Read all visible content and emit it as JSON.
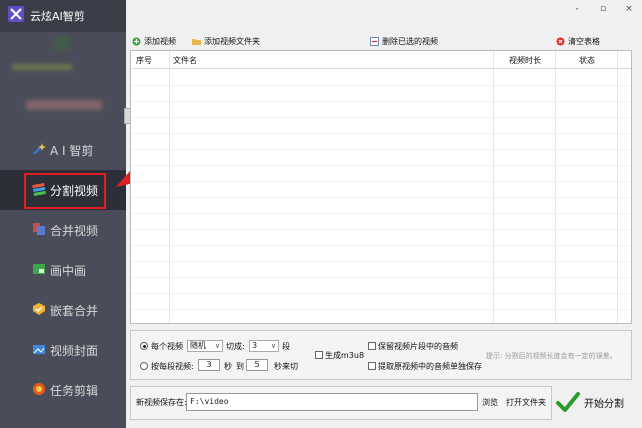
{
  "app": {
    "title": "云炫AI智剪"
  },
  "sidebar": {
    "items": [
      {
        "label": "A I 智剪",
        "icon": "ai-magic-icon",
        "active": false
      },
      {
        "label": "分割视频",
        "icon": "split-video-icon",
        "active": true
      },
      {
        "label": "合并视频",
        "icon": "merge-video-icon",
        "active": false
      },
      {
        "label": "画中画",
        "icon": "picture-in-picture-icon",
        "active": false
      },
      {
        "label": "嵌套合并",
        "icon": "nest-merge-icon",
        "active": false
      },
      {
        "label": "视频封面",
        "icon": "video-cover-icon",
        "active": false
      },
      {
        "label": "任务剪辑",
        "icon": "task-edit-icon",
        "active": false
      }
    ]
  },
  "window": {
    "minimize": "-",
    "maximize": "▫",
    "close": "×"
  },
  "toolbar": {
    "add_video": "添加视频",
    "add_folder": "添加视频文件夹",
    "delete_selected": "删除已选的视频",
    "clear_table": "清空表格"
  },
  "table": {
    "columns": [
      "序号",
      "文件名",
      "视频时长",
      "状态"
    ],
    "rows": []
  },
  "options": {
    "each_video_label": "每个视频",
    "mode_value": "随机",
    "cut_label": "切成:",
    "segments_value": "3",
    "segments_unit": "段",
    "by_segment_label": "按每段视频:",
    "seconds_from": "3",
    "seconds_unit": "秒",
    "to_label": "到",
    "seconds_to": "5",
    "seconds_cut": "秒来切",
    "generate_m3u8": "生成m3u8",
    "keep_audio": "保留视频片段中的音频",
    "extract_audio": "提取原视频中的音频单独保存",
    "hint": "提示: 分割后的视频长度会有一定的误差。",
    "each_video_selected": true
  },
  "save": {
    "label": "新视频保存在:",
    "path": "F:\\video",
    "browse": "浏览",
    "open_folder": "打开文件夹"
  },
  "start_button": {
    "label": "开始分割"
  },
  "colors": {
    "sidebar_bg": "#4a4c59",
    "highlight": "#e02020",
    "accent_green": "#2a9a2a"
  }
}
